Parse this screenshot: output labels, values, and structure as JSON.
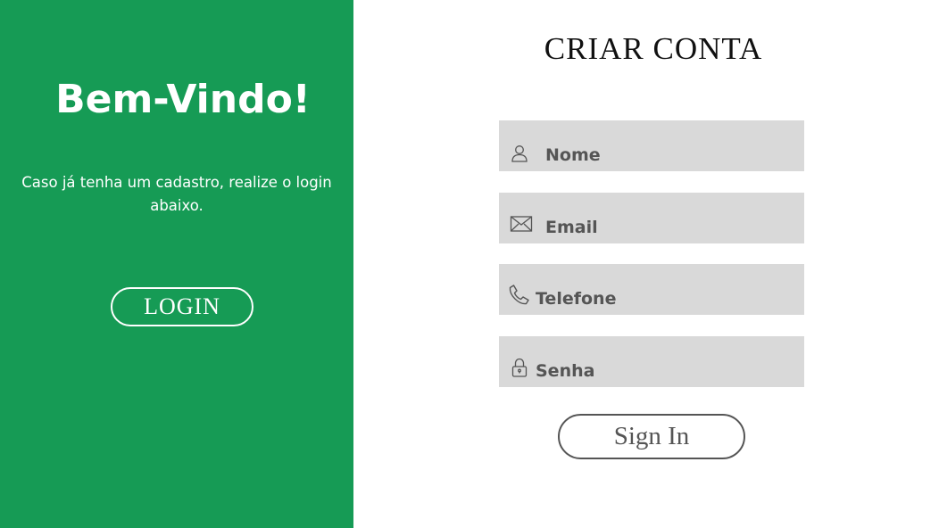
{
  "welcome": {
    "title": "Bem-Vindo!",
    "text": "Caso já tenha um cadastro, realize o login abaixo.",
    "login_label": "LOGIN"
  },
  "signup": {
    "title": "CRIAR CONTA",
    "fields": [
      {
        "label": "Nome",
        "icon": "user-icon"
      },
      {
        "label": "Email",
        "icon": "envelope-icon"
      },
      {
        "label": "Telefone",
        "icon": "phone-icon"
      },
      {
        "label": "Senha",
        "icon": "lock-icon"
      }
    ],
    "submit_label": "Sign In"
  },
  "colors": {
    "panel_green": "#169b55",
    "field_gray": "#d9d9d9",
    "text_gray": "#555555"
  }
}
